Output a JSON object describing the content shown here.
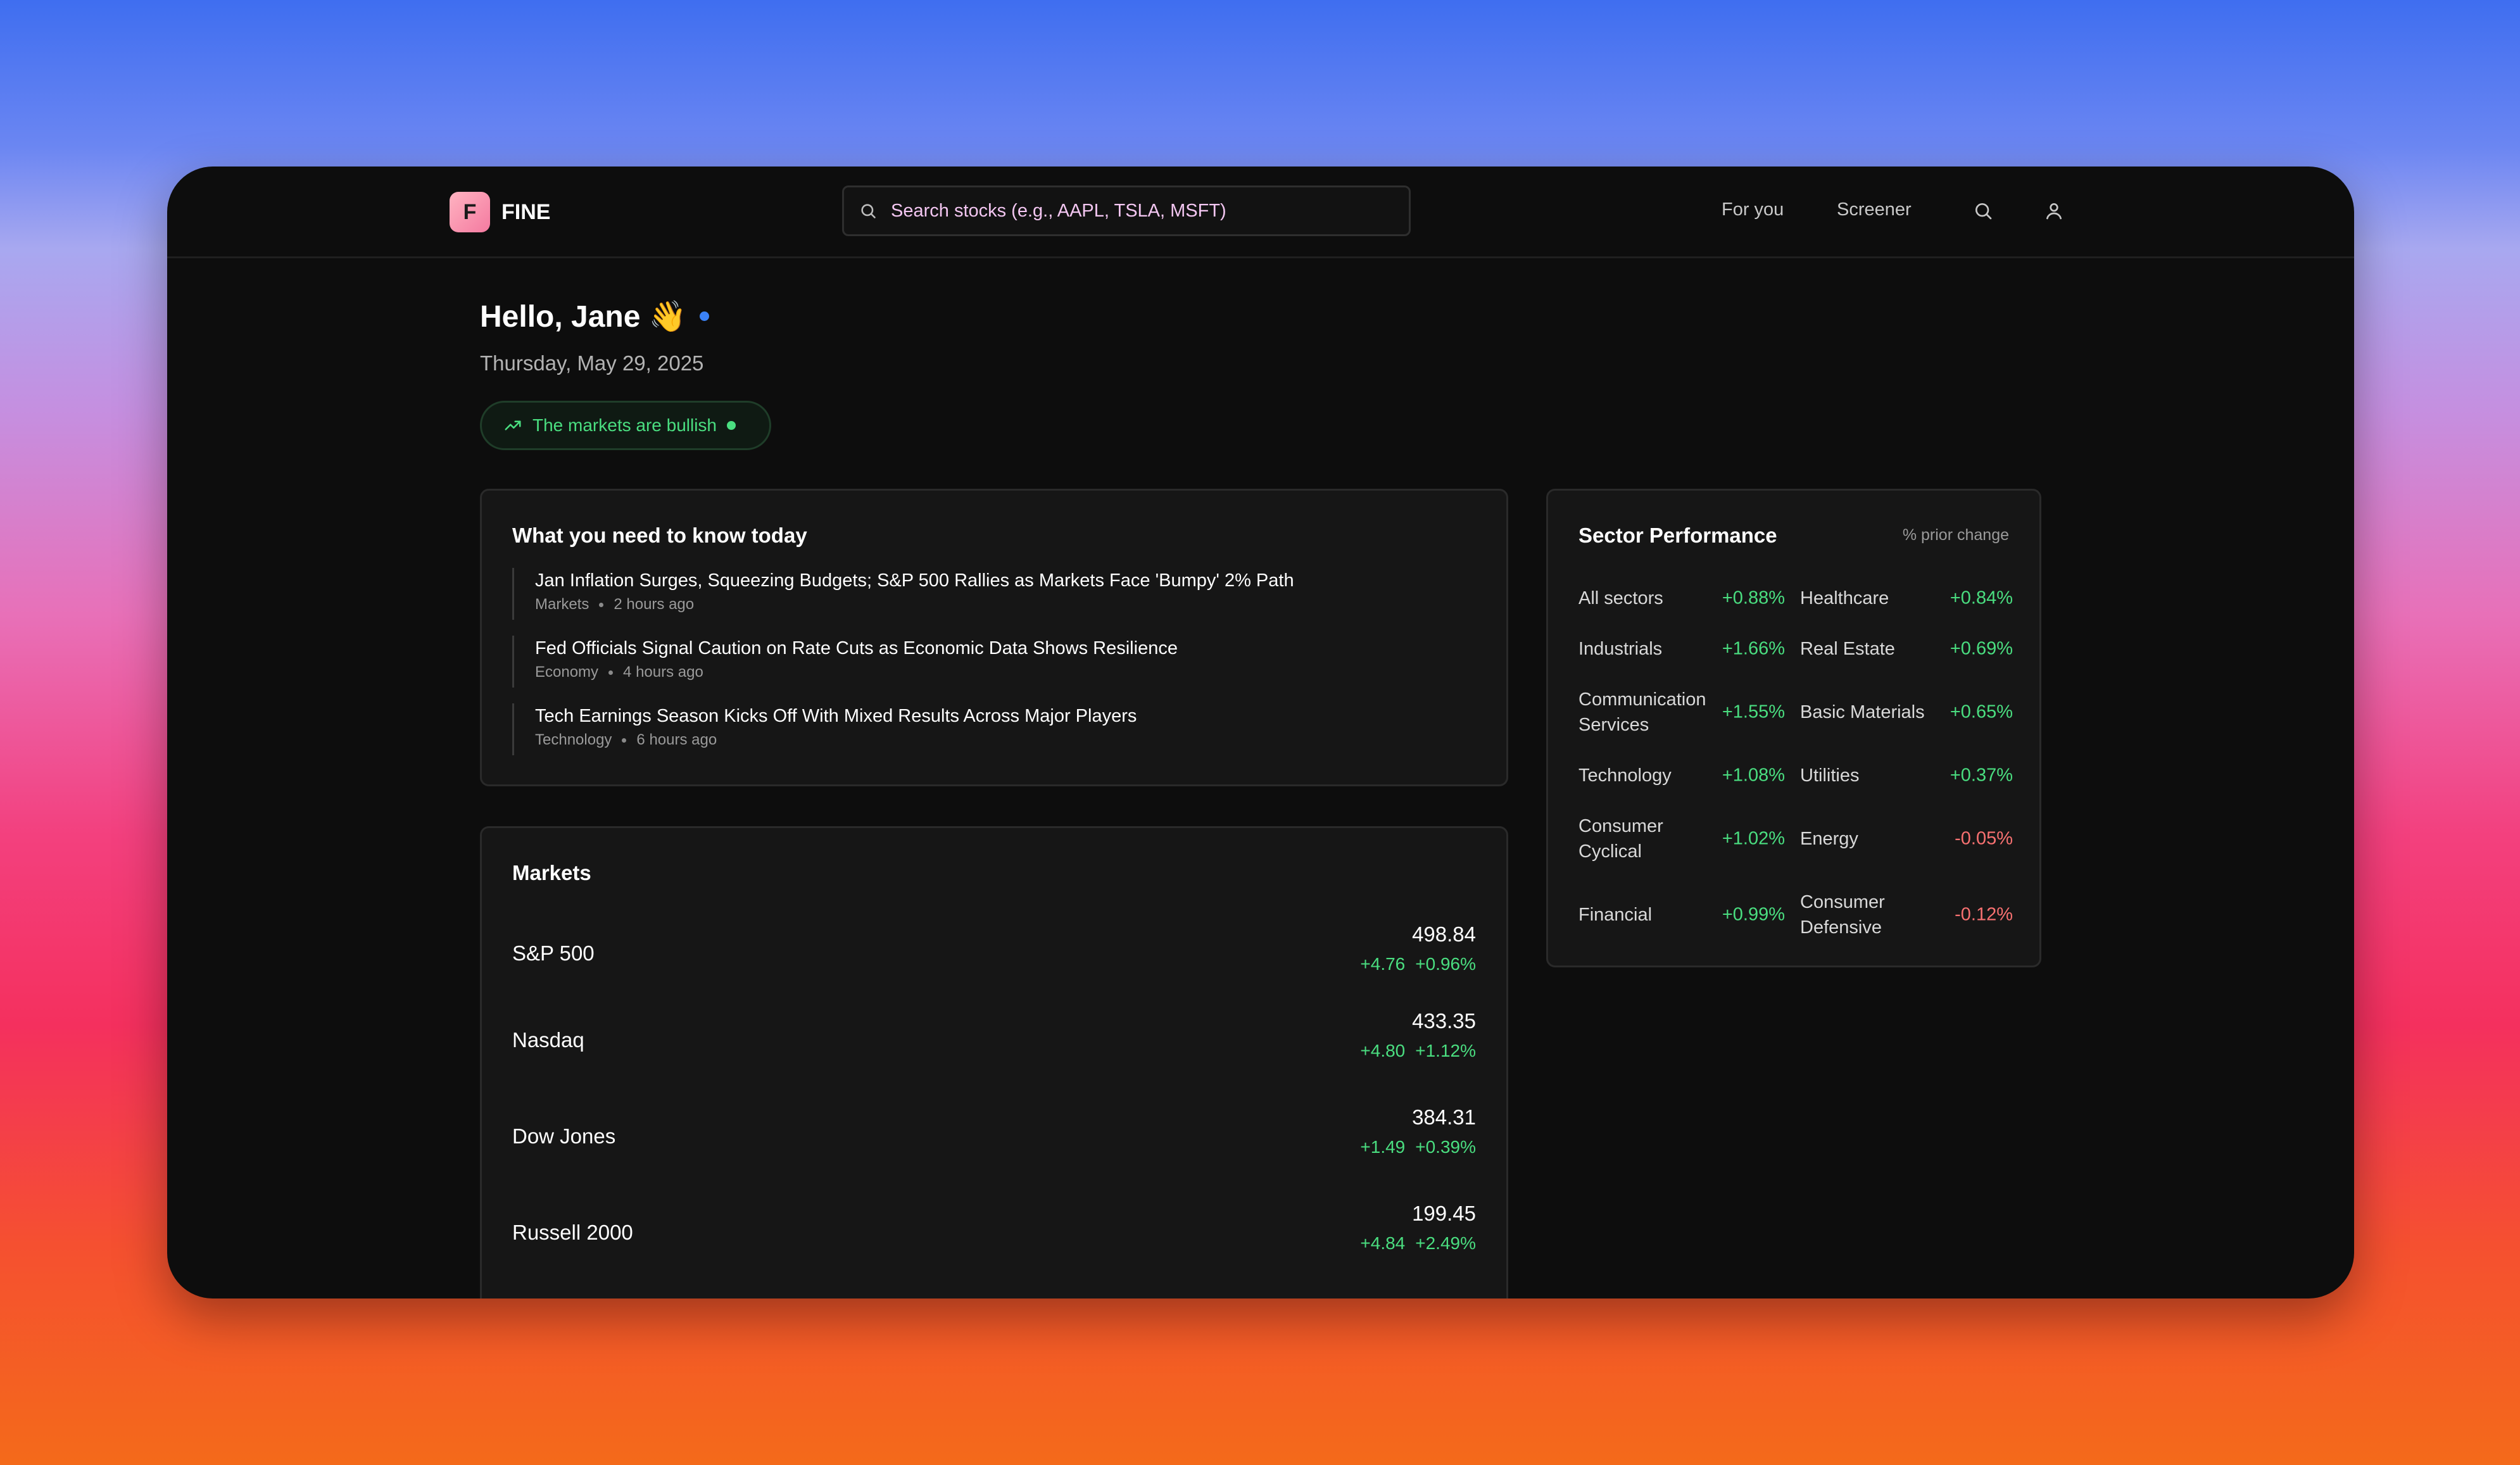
{
  "brand": {
    "logo_letter": "F",
    "name": "FINE"
  },
  "search": {
    "placeholder": "Search stocks (e.g., AAPL, TSLA, MSFT)"
  },
  "nav": {
    "for_you": "For you",
    "screener": "Screener",
    "icons": [
      "search-icon",
      "user-icon"
    ]
  },
  "greeting": {
    "text": "Hello, Jane 👋",
    "date": "Thursday, May 29, 2025"
  },
  "sentiment": {
    "text": "The markets are bullish",
    "color": "#4ade80"
  },
  "news": {
    "title": "What you need to know today",
    "items": [
      {
        "headline": "Jan Inflation Surges, Squeezing Budgets; S&P 500 Rallies as Markets Face 'Bumpy' 2% Path",
        "category": "Markets",
        "time": "2 hours ago"
      },
      {
        "headline": "Fed Officials Signal Caution on Rate Cuts as Economic Data Shows Resilience",
        "category": "Economy",
        "time": "4 hours ago"
      },
      {
        "headline": "Tech Earnings Season Kicks Off With Mixed Results Across Major Players",
        "category": "Technology",
        "time": "6 hours ago"
      }
    ]
  },
  "markets": {
    "title": "Markets",
    "rows": [
      {
        "name": "S&P 500",
        "price": "498.84",
        "change": "+4.76",
        "pct": "+0.96%"
      },
      {
        "name": "Nasdaq",
        "price": "433.35",
        "change": "+4.80",
        "pct": "+1.12%"
      },
      {
        "name": "Dow Jones",
        "price": "384.31",
        "change": "+1.49",
        "pct": "+0.39%"
      },
      {
        "name": "Russell 2000",
        "price": "199.45",
        "change": "+4.84",
        "pct": "+2.49%"
      }
    ]
  },
  "sectors": {
    "title": "Sector Performance",
    "subtitle": "% prior change",
    "left": [
      {
        "name": "All sectors",
        "value": "+0.88%"
      },
      {
        "name": "Industrials",
        "value": "+1.66%"
      },
      {
        "name": "Communication Services",
        "value": "+1.55%"
      },
      {
        "name": "Technology",
        "value": "+1.08%"
      },
      {
        "name": "Consumer Cyclical",
        "value": "+1.02%"
      },
      {
        "name": "Financial",
        "value": "+0.99%"
      }
    ],
    "right": [
      {
        "name": "Healthcare",
        "value": "+0.84%"
      },
      {
        "name": "Real Estate",
        "value": "+0.69%"
      },
      {
        "name": "Basic Materials",
        "value": "+0.65%"
      },
      {
        "name": "Utilities",
        "value": "+0.37%"
      },
      {
        "name": "Energy",
        "value": "-0.05%"
      },
      {
        "name": "Consumer Defensive",
        "value": "-0.12%"
      }
    ]
  },
  "colors": {
    "positive": "#4ade80",
    "negative": "#f87171",
    "accent": "#3b82f6"
  }
}
